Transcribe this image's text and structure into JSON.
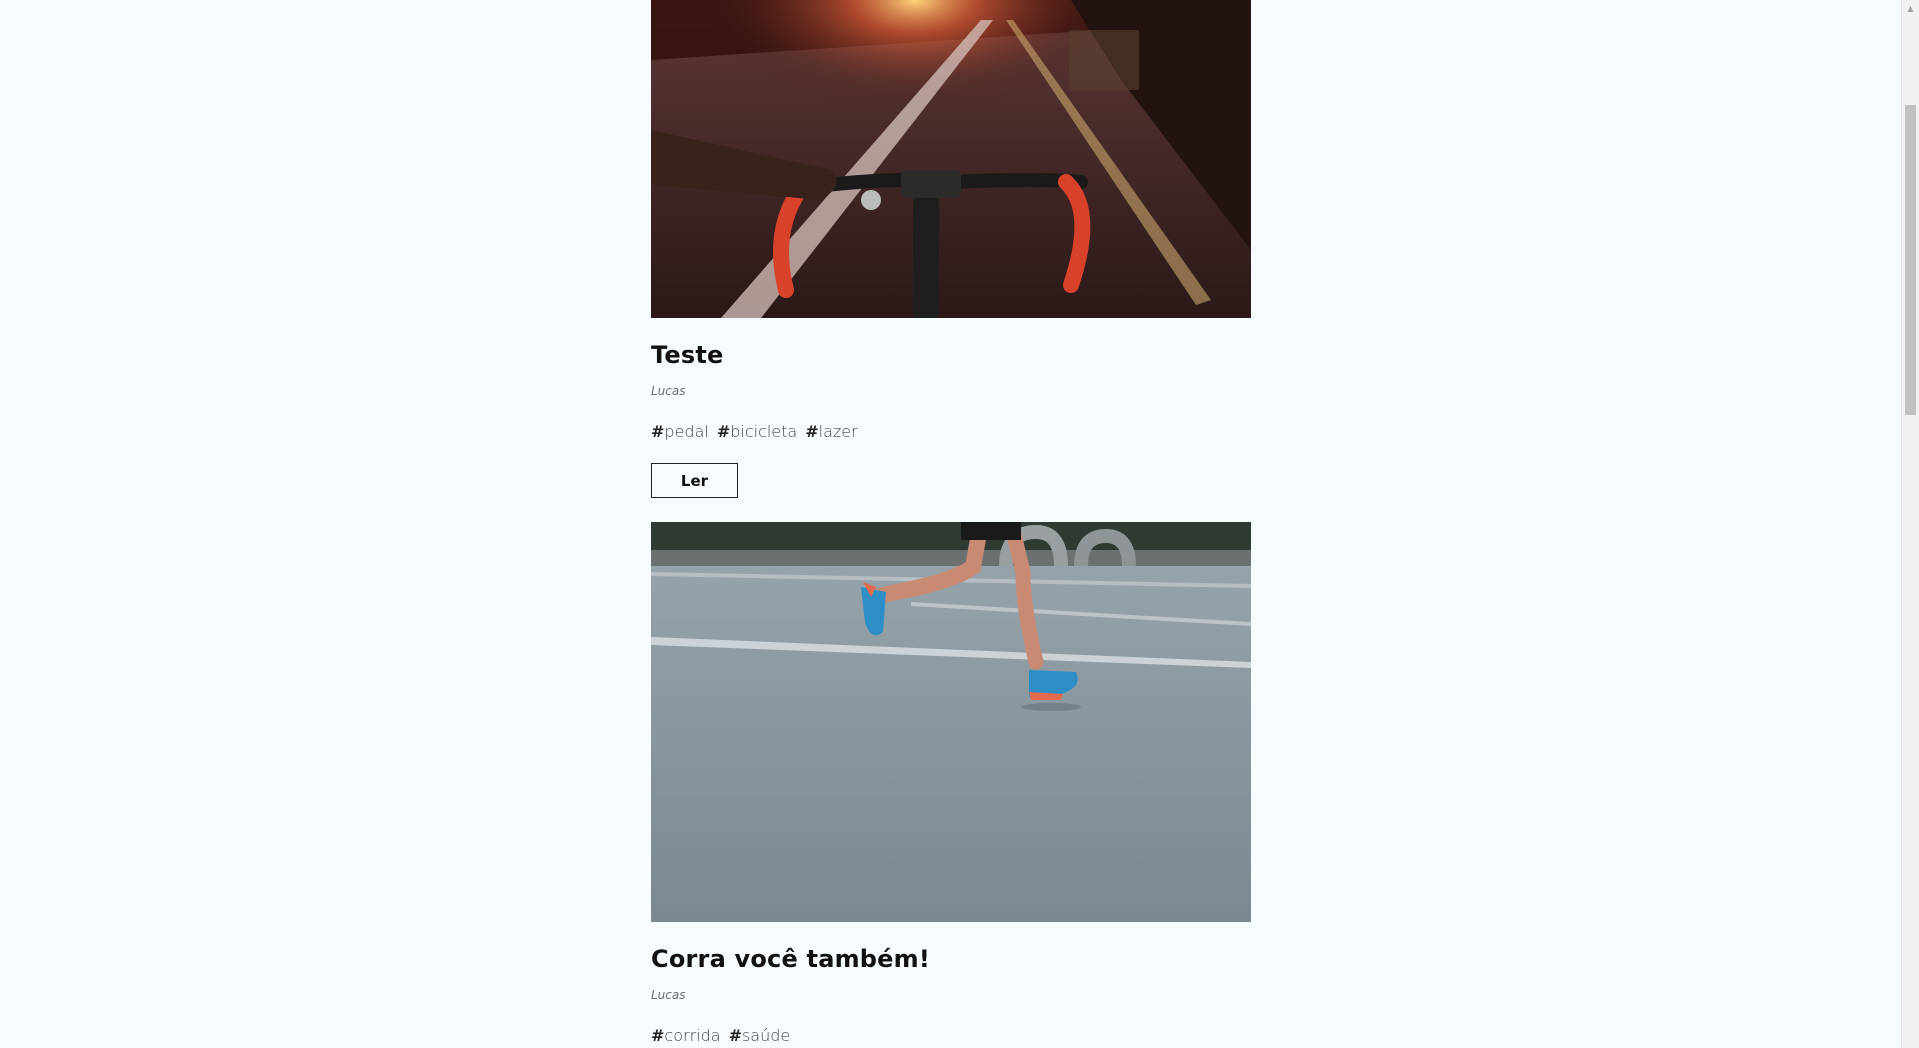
{
  "posts": [
    {
      "image_alt": "bicycle-road-photo",
      "title": "Teste",
      "author": "Lucas",
      "tags": [
        "pedal",
        "bicicleta",
        "lazer"
      ],
      "button_label": "Ler"
    },
    {
      "image_alt": "runner-road-photo",
      "title": "Corra você também!",
      "author": "Lucas",
      "tags": [
        "corrida",
        "saúde"
      ],
      "button_label": "Ler"
    }
  ],
  "tag_prefix": "#",
  "colors": {
    "background": "#f6fbff",
    "text": "#111111",
    "author": "#6c6c6c",
    "scrollbar_thumb": "#c1c1c1"
  }
}
